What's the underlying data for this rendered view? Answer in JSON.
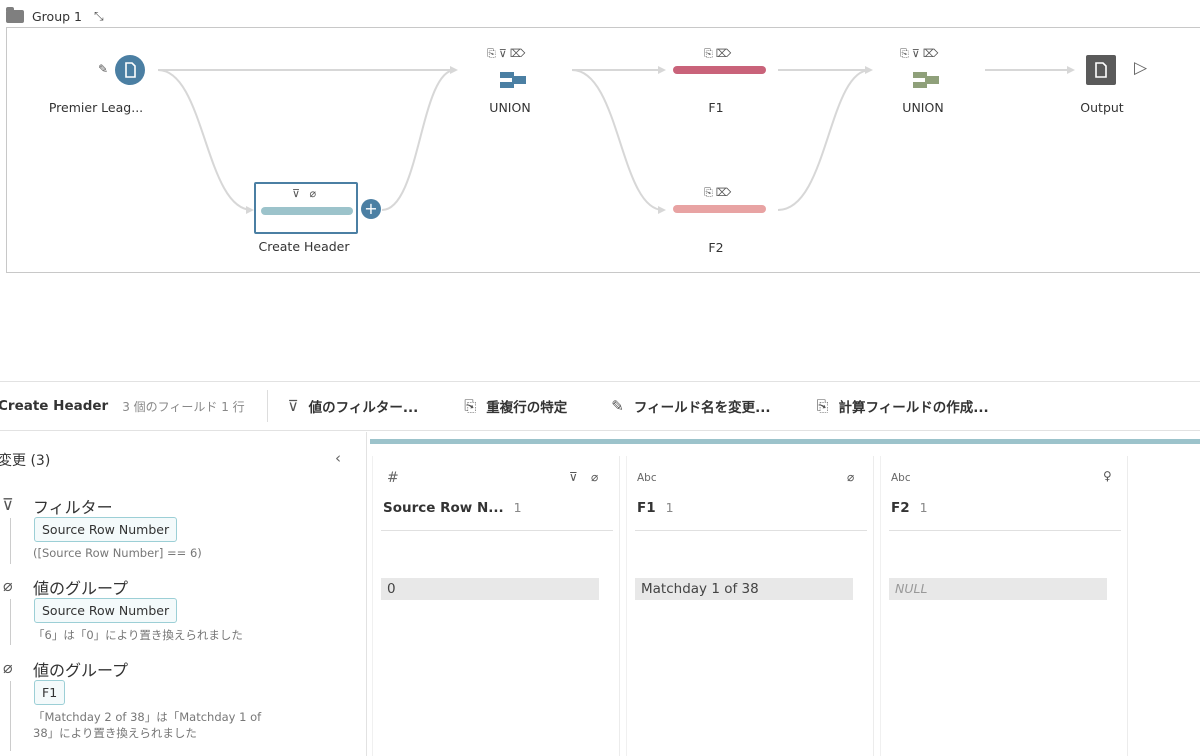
{
  "group": {
    "name": "Group 1"
  },
  "flow": {
    "input_node": {
      "label": "Premier Leag..."
    },
    "clean_node": {
      "label": "Create Header"
    },
    "union1": {
      "label": "UNION"
    },
    "f1_node": {
      "label": "F1"
    },
    "f2_node": {
      "label": "F2"
    },
    "union2": {
      "label": "UNION"
    },
    "output": {
      "label": "Output"
    }
  },
  "toolbar": {
    "step_name": "Create Header",
    "meta": "3 個のフィールド  1 行",
    "filter": "値のフィルター...",
    "dedupe": "重複行の特定",
    "rename": "フィールド名を変更...",
    "calc": "計算フィールドの作成..."
  },
  "changes": {
    "title": "変更 (3)",
    "items": [
      {
        "type": "フィルター",
        "field": "Source Row Number",
        "desc": "([Source Row Number] == 6)"
      },
      {
        "type": "値のグループ",
        "field": "Source Row Number",
        "desc": "「6」は「0」により置き換えられました"
      },
      {
        "type": "値のグループ",
        "field": "F1",
        "desc_line1": "「Matchday 2 of 38」は「Matchday 1 of",
        "desc_line2": "38」により置き換えられました"
      }
    ]
  },
  "cards": [
    {
      "type": "#",
      "name": "Source Row N...",
      "count": "1",
      "value": "0"
    },
    {
      "type": "Abc",
      "name": "F1",
      "count": "1",
      "value": "Matchday 1 of 38"
    },
    {
      "type": "Abc",
      "name": "F2",
      "count": "1",
      "value": "NULL"
    }
  ],
  "colors": {
    "input": "#4b7fa3",
    "clean_bar": "#9cc3cb",
    "f1_bar": "#c9637a",
    "f2_bar": "#e8a3a3",
    "union1": "#4b7fa3",
    "union2": "#8fa07a",
    "output": "#5a5a5a"
  }
}
